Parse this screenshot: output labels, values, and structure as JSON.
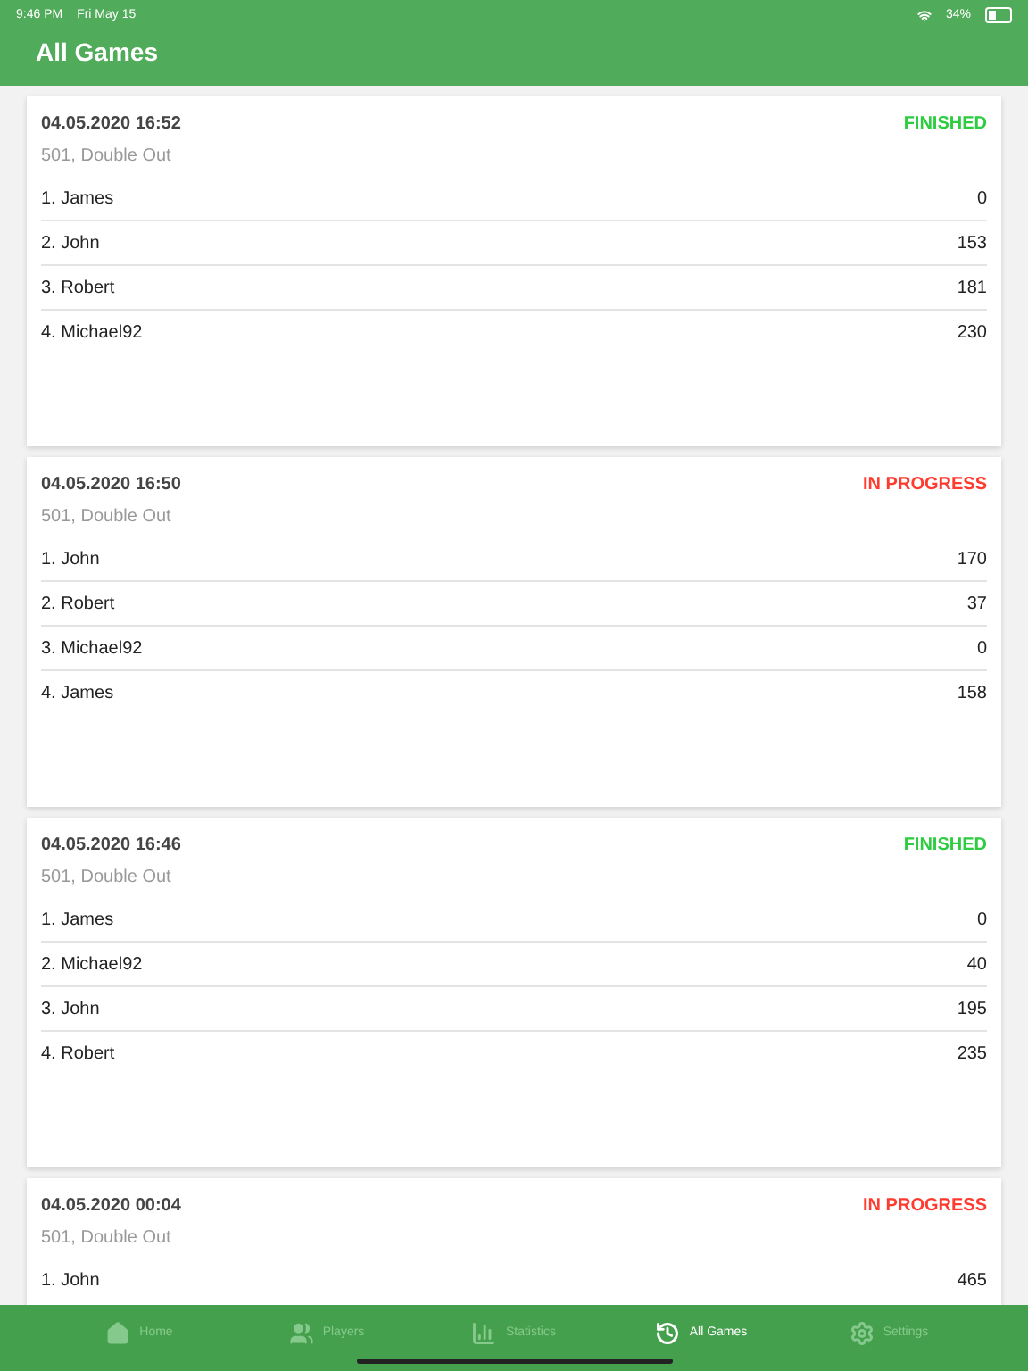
{
  "status_bar": {
    "time": "9:46 PM",
    "date": "Fri May 15",
    "battery": "34%"
  },
  "header": {
    "title": "All Games"
  },
  "games": [
    {
      "date": "04.05.2020 16:52",
      "status": "FINISHED",
      "kind": "finished",
      "mode": "501, Double Out",
      "players": [
        {
          "name": "1. James",
          "score": "0"
        },
        {
          "name": "2. John",
          "score": "153"
        },
        {
          "name": "3. Robert",
          "score": "181"
        },
        {
          "name": "4. Michael92",
          "score": "230"
        }
      ]
    },
    {
      "date": "04.05.2020 16:50",
      "status": "IN PROGRESS",
      "kind": "in_progress",
      "mode": "501, Double Out",
      "players": [
        {
          "name": "1. John",
          "score": "170"
        },
        {
          "name": "2. Robert",
          "score": "37"
        },
        {
          "name": "3. Michael92",
          "score": "0"
        },
        {
          "name": "4. James",
          "score": "158"
        }
      ]
    },
    {
      "date": "04.05.2020 16:46",
      "status": "FINISHED",
      "kind": "finished",
      "mode": "501, Double Out",
      "players": [
        {
          "name": "1. James",
          "score": "0"
        },
        {
          "name": "2. Michael92",
          "score": "40"
        },
        {
          "name": "3. John",
          "score": "195"
        },
        {
          "name": "4. Robert",
          "score": "235"
        }
      ]
    },
    {
      "date": "04.05.2020 00:04",
      "status": "IN PROGRESS",
      "kind": "in_progress",
      "mode": "501, Double Out",
      "players": [
        {
          "name": "1. John",
          "score": "465"
        }
      ]
    }
  ],
  "tabs": [
    {
      "label": "Home",
      "kind": "home",
      "selected": false
    },
    {
      "label": "Players",
      "kind": "players",
      "selected": false
    },
    {
      "label": "Statistics",
      "kind": "statistics",
      "selected": false
    },
    {
      "label": "All Games",
      "kind": "history",
      "selected": true
    },
    {
      "label": "Settings",
      "kind": "settings",
      "selected": false
    }
  ]
}
